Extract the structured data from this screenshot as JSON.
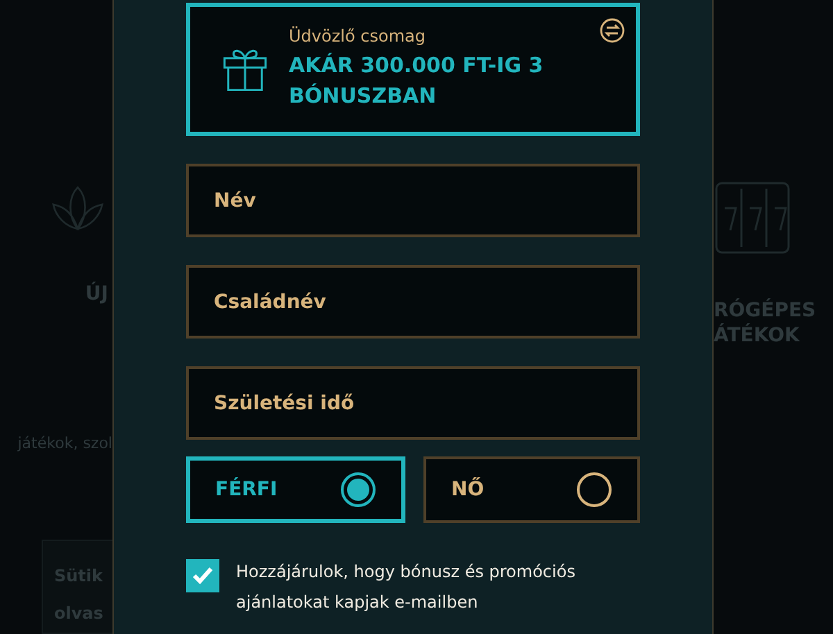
{
  "background": {
    "left": {
      "category": "ÚJ",
      "description": "játékok, szol",
      "cookie_lines": [
        "Sütik",
        "olvas"
      ]
    },
    "right": {
      "category_lines": [
        "RÓGÉPES",
        "ÁTÉKOK"
      ]
    }
  },
  "promo": {
    "subtitle": "Üdvözlő csomag",
    "title": "AKÁR 300.000 FT-IG 3 BÓNUSZBAN"
  },
  "fields": [
    {
      "placeholder": "Név"
    },
    {
      "placeholder": "Családnév"
    },
    {
      "placeholder": "Születési idő"
    }
  ],
  "gender": [
    {
      "label": "FÉRFI",
      "selected": true
    },
    {
      "label": "NŐ",
      "selected": false
    }
  ],
  "consent": {
    "checked": true,
    "text": "Hozzájárulok, hogy bónusz és promóciós ajánlatokat kapjak e-mailben"
  }
}
